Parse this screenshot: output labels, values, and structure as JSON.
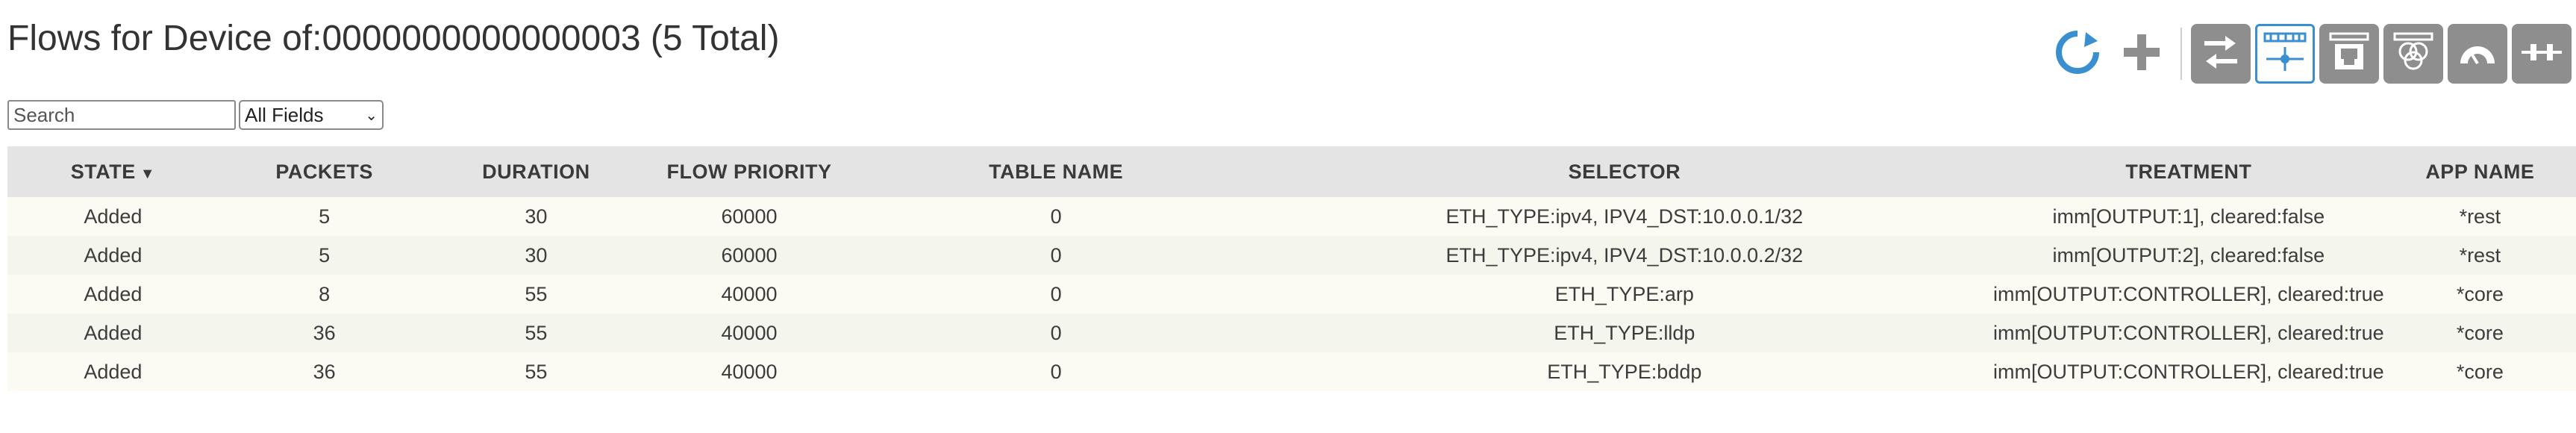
{
  "page": {
    "title": "Flows for Device of:0000000000000003 (5 Total)"
  },
  "toolbar": {
    "buttons": [
      {
        "name": "refresh-icon"
      },
      {
        "name": "add-flow-icon"
      },
      {
        "name": "switch-view-icon"
      },
      {
        "name": "flows-view-icon",
        "selected": true
      },
      {
        "name": "ports-view-icon"
      },
      {
        "name": "groups-view-icon"
      },
      {
        "name": "meters-view-icon"
      },
      {
        "name": "pipeconf-view-icon"
      }
    ],
    "colors": {
      "accent": "#3a8fd0",
      "button_gray": "#8e8e8e"
    }
  },
  "search": {
    "placeholder": "Search",
    "value": "",
    "field_selected": "All Fields"
  },
  "table": {
    "headers": {
      "state": "STATE",
      "packets": "PACKETS",
      "duration": "DURATION",
      "priority": "FLOW PRIORITY",
      "table_name": "TABLE NAME",
      "selector": "SELECTOR",
      "treatment": "TREATMENT",
      "app_name": "APP NAME"
    },
    "sort_indicator": "▼",
    "rows": [
      {
        "state": "Added",
        "packets": "5",
        "duration": "30",
        "priority": "60000",
        "table_name": "0",
        "selector": "ETH_TYPE:ipv4, IPV4_DST:10.0.0.1/32",
        "treatment": "imm[OUTPUT:1], cleared:false",
        "app_name": "*rest"
      },
      {
        "state": "Added",
        "packets": "5",
        "duration": "30",
        "priority": "60000",
        "table_name": "0",
        "selector": "ETH_TYPE:ipv4, IPV4_DST:10.0.0.2/32",
        "treatment": "imm[OUTPUT:2], cleared:false",
        "app_name": "*rest"
      },
      {
        "state": "Added",
        "packets": "8",
        "duration": "55",
        "priority": "40000",
        "table_name": "0",
        "selector": "ETH_TYPE:arp",
        "treatment": "imm[OUTPUT:CONTROLLER], cleared:true",
        "app_name": "*core"
      },
      {
        "state": "Added",
        "packets": "36",
        "duration": "55",
        "priority": "40000",
        "table_name": "0",
        "selector": "ETH_TYPE:lldp",
        "treatment": "imm[OUTPUT:CONTROLLER], cleared:true",
        "app_name": "*core"
      },
      {
        "state": "Added",
        "packets": "36",
        "duration": "55",
        "priority": "40000",
        "table_name": "0",
        "selector": "ETH_TYPE:bddp",
        "treatment": "imm[OUTPUT:CONTROLLER], cleared:true",
        "app_name": "*core"
      }
    ]
  }
}
